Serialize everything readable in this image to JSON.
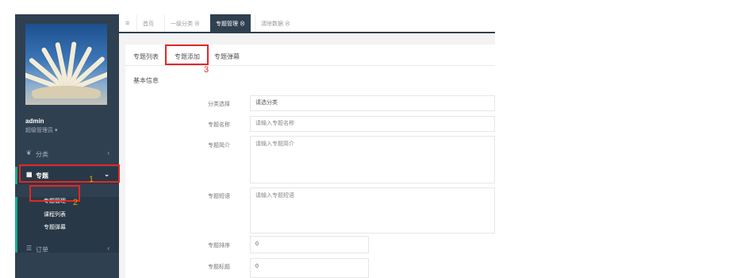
{
  "sidebar": {
    "user_name": "admin",
    "user_role": "超级管理员 ▾",
    "items": [
      {
        "label": "分类",
        "icon": "leaf-icon"
      },
      {
        "label": "专题",
        "icon": "table-icon"
      },
      {
        "label": "订单",
        "icon": "list-icon"
      }
    ],
    "subitems": [
      "专题管理",
      "课程列表",
      "专题弹幕"
    ]
  },
  "tabs": {
    "menu_icon": "≡",
    "items": [
      "首页",
      "一级分类 ⊗",
      "专题管理 ⊗",
      "清除数据 ⊗"
    ]
  },
  "subtabs": [
    "专题列表",
    "专题添加",
    "专题弹幕"
  ],
  "form": {
    "section_title": "基本信息",
    "fields": [
      {
        "label": "分类选择",
        "value": "请选分类"
      },
      {
        "label": "专题名称",
        "placeholder": "请输入专题名称"
      },
      {
        "label": "专题简介",
        "placeholder": "请输入专题简介"
      },
      {
        "label": "专题短语",
        "placeholder": "请输入专题短语"
      },
      {
        "label": "专题排序",
        "value": "0"
      },
      {
        "label": "专题标题",
        "value": "0"
      }
    ]
  },
  "annotations": [
    "1",
    "2",
    "3"
  ],
  "colors": {
    "sidebar": "#2f4050",
    "accent": "#19aa8d",
    "highlight": "#e32626",
    "num1": "#d9a400"
  }
}
